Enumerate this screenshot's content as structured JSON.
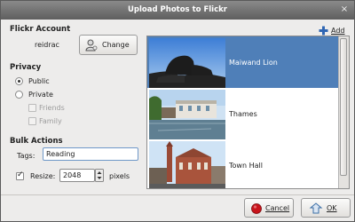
{
  "window": {
    "title": "Upload Photos to Flickr",
    "close_glyph": "×"
  },
  "account": {
    "heading": "Flickr Account",
    "username": "reidrac",
    "change_label": "Change"
  },
  "privacy": {
    "heading": "Privacy",
    "public_label": "Public",
    "private_label": "Private",
    "friends_label": "Friends",
    "family_label": "Family",
    "selected": "Public"
  },
  "bulk": {
    "heading": "Bulk Actions",
    "tags_label": "Tags:",
    "tags_value": "Reading",
    "resize_label": "Resize:",
    "resize_value": "2048",
    "resize_unit": "pixels",
    "resize_checked": true
  },
  "toolbar": {
    "add_label": "Add"
  },
  "photos": [
    {
      "name": "Maiwand Lion",
      "selected": true
    },
    {
      "name": "Thames",
      "selected": false
    },
    {
      "name": "Town Hall",
      "selected": false
    }
  ],
  "footer": {
    "cancel_label": "Cancel",
    "ok_label": "OK"
  },
  "colors": {
    "selection": "#4f7fb8",
    "titlebar": "#6f6f6f",
    "cancel_icon": "#c8141b"
  }
}
